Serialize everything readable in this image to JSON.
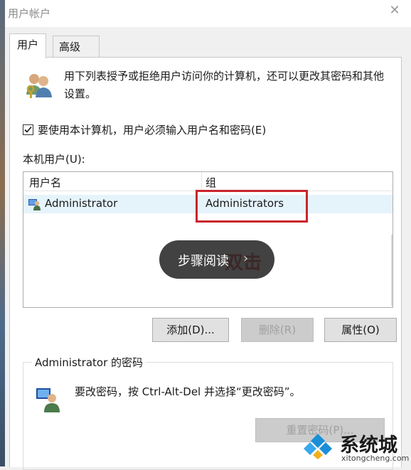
{
  "window": {
    "title": "用户帐户"
  },
  "tabs": [
    {
      "label": "用户",
      "active": true
    },
    {
      "label": "高级",
      "active": false
    }
  ],
  "intro": {
    "text": "用下列表授予或拒绝用户访问你的计算机，还可以更改其密码和其他设置。"
  },
  "checkbox": {
    "label": "要使用本计算机，用户必须输入用户名和密码(E)",
    "checked": true
  },
  "local_users": {
    "label": "本机用户(U):",
    "columns": [
      "用户名",
      "组"
    ],
    "rows": [
      {
        "username": "Administrator",
        "group": "Administrators"
      }
    ]
  },
  "overlay": {
    "pill_text": "步骤阅读",
    "pill_chevron": "›",
    "red_text": "双击"
  },
  "buttons": {
    "add": "添加(D)...",
    "remove": "删除(R)",
    "properties": "属性(O)"
  },
  "password_group": {
    "title": "Administrator 的密码",
    "text": "要改密码，按 Ctrl-Alt-Del 并选择“更改密码”。",
    "reset_button": "重置密码(P)..."
  },
  "watermark": {
    "name": "系统城",
    "url": "xitongcheng.com"
  },
  "colors": {
    "highlight_red": "#c9252c",
    "selected_row": "#e5f3fb",
    "watermark_blue": "#1a8fd8"
  },
  "icons": [
    "users-icon",
    "checkmark-icon",
    "user-row-icon",
    "close-icon",
    "password-user-icon",
    "watermark-logo-icon"
  ]
}
